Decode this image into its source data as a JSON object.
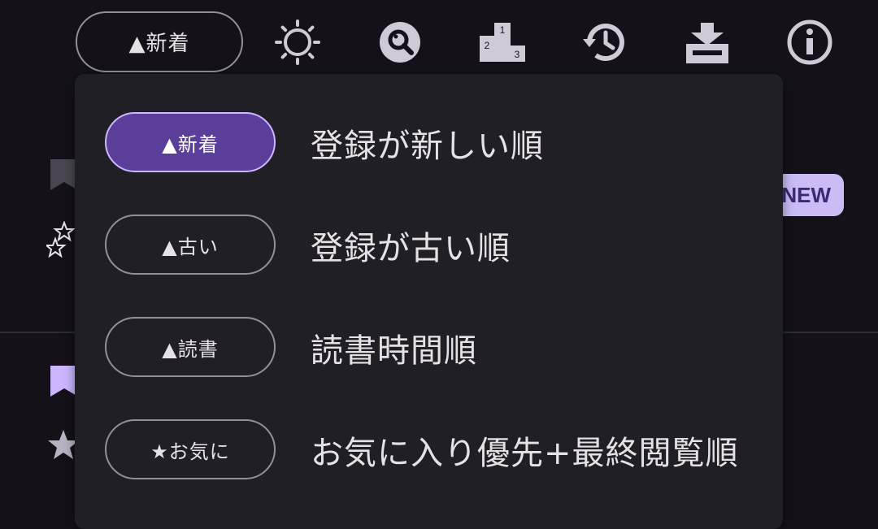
{
  "toolbar": {
    "sort_chip_label": "▲新着",
    "icons": [
      "brightness-icon",
      "search-icon",
      "ranking-icon",
      "history-icon",
      "download-icon",
      "info-icon"
    ],
    "ranking_numbers": [
      "1",
      "2",
      "3"
    ]
  },
  "background_list": {
    "new_badge": "NEW"
  },
  "sort_menu": {
    "items": [
      {
        "chip": "▲新着",
        "label": "登録が新しい順",
        "selected": true
      },
      {
        "chip": "▲古い",
        "label": "登録が古い順",
        "selected": false
      },
      {
        "chip": "▲読書",
        "label": "読書時間順",
        "selected": false
      },
      {
        "chip": "★お気に",
        "label": "お気に入り優先+最終閲覧順",
        "selected": false
      }
    ]
  },
  "colors": {
    "background": "#141218",
    "menu_surface": "#211f26",
    "selected_chip": "#5a3e99",
    "accent": "#cbbcf6",
    "outline": "#938f99",
    "icon": "#cfcbd6"
  }
}
